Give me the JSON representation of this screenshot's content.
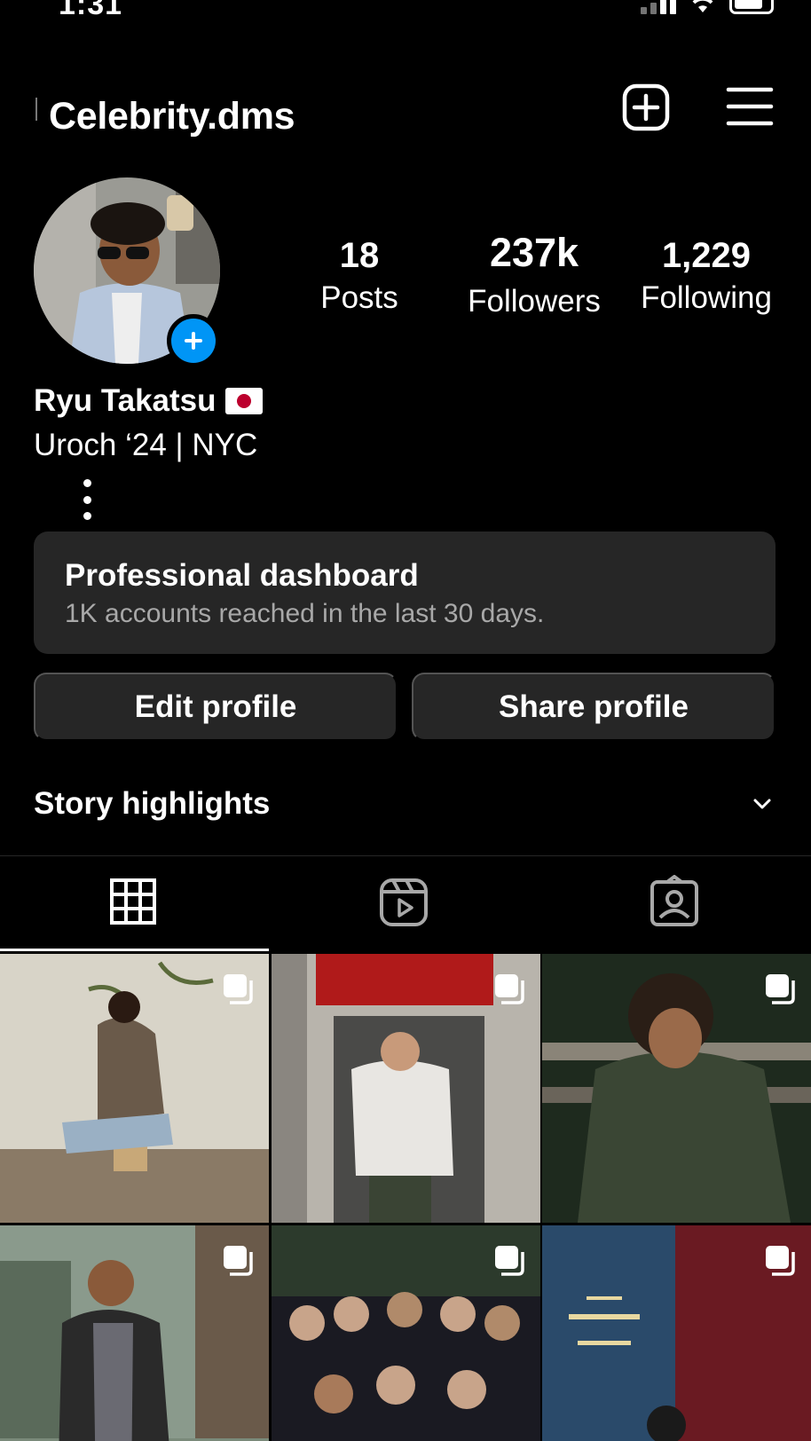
{
  "status_bar": {
    "time": "1:31"
  },
  "header": {
    "username": "Celebrity.dms"
  },
  "stats": [
    {
      "key": "posts",
      "value": "18",
      "label": "Posts"
    },
    {
      "key": "followers",
      "value": "237k",
      "label": "Followers"
    },
    {
      "key": "following",
      "value": "1,229",
      "label": "Following"
    }
  ],
  "bio": {
    "name": "Ryu Takatsu",
    "line": "Uroch ‘24 | NYC"
  },
  "dashboard": {
    "title": "Professional dashboard",
    "subtitle": "1K accounts reached in the last 30 days."
  },
  "actions": {
    "edit": "Edit profile",
    "share": "Share profile"
  },
  "highlights": {
    "title": "Story highlights"
  },
  "tabs": [
    {
      "icon": "grid-icon",
      "selected": true
    },
    {
      "icon": "reels-icon",
      "selected": false
    },
    {
      "icon": "tagged-icon",
      "selected": false
    }
  ],
  "posts": [
    {
      "multiple": true,
      "palette": [
        "#d8d4c8",
        "#8a7a66",
        "#5a4a3a"
      ]
    },
    {
      "multiple": true,
      "palette": [
        "#b8b4ac",
        "#e8e6e2",
        "#b01a1a"
      ]
    },
    {
      "multiple": true,
      "palette": [
        "#3a4634",
        "#1e2a1e",
        "#8a8478"
      ]
    },
    {
      "multiple": true,
      "palette": [
        "#5a6a5a",
        "#2a2a2a",
        "#8a9a8c"
      ]
    },
    {
      "multiple": true,
      "palette": [
        "#2c3a2c",
        "#1a1a22",
        "#c8a48a"
      ]
    },
    {
      "multiple": true,
      "palette": [
        "#2a4a6a",
        "#6a1a22",
        "#e8d8a0"
      ]
    }
  ],
  "colors": {
    "accent": "#0095f6",
    "surface": "#262626",
    "muted": "#a8a8a8",
    "flag_red": "#bc002d"
  }
}
